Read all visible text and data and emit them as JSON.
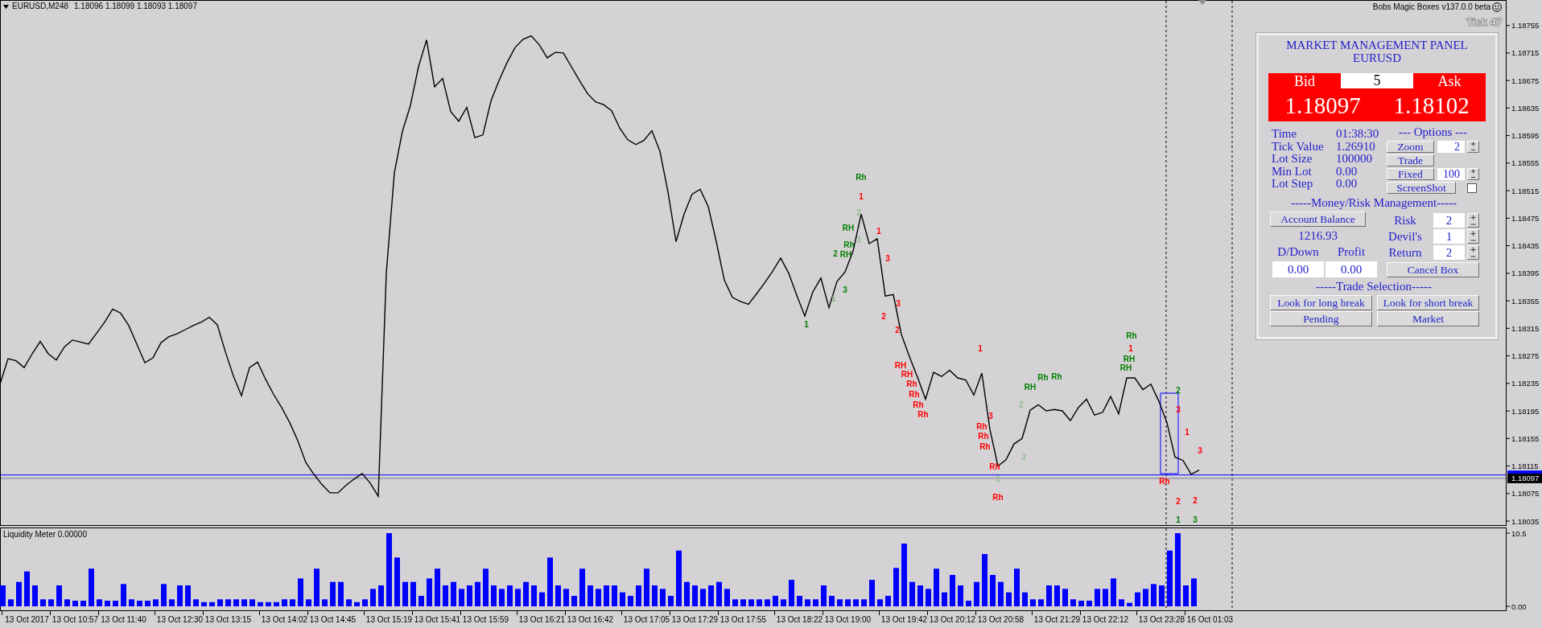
{
  "chart": {
    "header": {
      "symbol": "EURUSD,M248",
      "ohlc": "1.18096 1.18099 1.18093 1.18097"
    },
    "indicator_name": "Bobs Magic Boxes v137.0.0 beta",
    "tick_counter": "Tick 47",
    "chart_data": {
      "type": "line",
      "categories": [
        null,
        null,
        null,
        null,
        null,
        null,
        null,
        null,
        null,
        null,
        null,
        null,
        null,
        null,
        null,
        null,
        null,
        null,
        null,
        null,
        null,
        null,
        null,
        null,
        null,
        null,
        null,
        null,
        null,
        null,
        null,
        null,
        null,
        null,
        null,
        null,
        null,
        null,
        null,
        null,
        null,
        null,
        null,
        null,
        null,
        null,
        null,
        null,
        null,
        null,
        null,
        null,
        null,
        null,
        null,
        null,
        null,
        null,
        null,
        null,
        null,
        null,
        null,
        null,
        null,
        null,
        null,
        null,
        null,
        null,
        null,
        null,
        null,
        null,
        null,
        null,
        null,
        null,
        null,
        null,
        null,
        null,
        null,
        null,
        null,
        null,
        null,
        null,
        null,
        null,
        null,
        null,
        null,
        null,
        null,
        null,
        null,
        null,
        null,
        null,
        null,
        null,
        null,
        null,
        null,
        null,
        null,
        null,
        null,
        null,
        null,
        null,
        null,
        null,
        null,
        null,
        null,
        null,
        null,
        null,
        null,
        null,
        null,
        null,
        null,
        null,
        null,
        null,
        null,
        null,
        null,
        null,
        null,
        null,
        null,
        null,
        null,
        null,
        null,
        null,
        null,
        null,
        null,
        null,
        null,
        null,
        null,
        null,
        null,
        null
      ],
      "ylim": [
        1.18028,
        1.18792
      ],
      "yticks": [
        1.18755,
        1.18715,
        1.18675,
        1.18635,
        1.18595,
        1.18555,
        1.18515,
        1.18475,
        1.18435,
        1.18395,
        1.18355,
        1.18315,
        1.18275,
        1.18235,
        1.18195,
        1.18155,
        1.18115,
        1.18075,
        1.18035
      ],
      "series": [
        {
          "color": "#000000",
          "values": [
            1.18234,
            1.18271,
            1.18268,
            1.18258,
            1.18278,
            1.18296,
            1.18278,
            1.18269,
            1.18288,
            1.18298,
            1.18295,
            1.18292,
            1.18308,
            1.18324,
            1.18343,
            1.18337,
            1.18319,
            1.18292,
            1.18265,
            1.18272,
            1.18294,
            1.18303,
            1.18307,
            1.18313,
            1.18319,
            1.18324,
            1.18331,
            1.1832,
            1.18281,
            1.18246,
            1.18217,
            1.18258,
            1.18266,
            1.18241,
            1.18219,
            1.182,
            1.18178,
            1.18152,
            1.1812,
            1.18103,
            1.18088,
            1.18076,
            1.18076,
            1.18087,
            1.18096,
            1.18104,
            1.1809,
            1.18071,
            1.18395,
            1.18541,
            1.18601,
            1.18639,
            1.18695,
            1.18734,
            1.18666,
            1.18678,
            1.1863,
            1.18616,
            1.18636,
            1.18592,
            1.18596,
            1.18645,
            1.18675,
            1.18701,
            1.18723,
            1.18735,
            1.1874,
            1.18727,
            1.18708,
            1.18716,
            1.18715,
            1.18695,
            1.18675,
            1.18656,
            1.18644,
            1.1864,
            1.18631,
            1.18606,
            1.18589,
            1.18582,
            1.18588,
            1.18602,
            1.18572,
            1.18513,
            1.18441,
            1.18481,
            1.1851,
            1.18517,
            1.18492,
            1.18441,
            1.18385,
            1.1836,
            1.18354,
            1.1835,
            1.18365,
            1.18381,
            1.18398,
            1.18417,
            1.18395,
            1.18363,
            1.18333,
            1.18368,
            1.18388,
            1.18345,
            1.18383,
            1.18397,
            1.18427,
            1.18481,
            1.18438,
            1.18445,
            1.18362,
            1.18364,
            1.18306,
            1.18274,
            1.18244,
            1.18212,
            1.18251,
            1.18245,
            1.18254,
            1.18243,
            1.1824,
            1.18218,
            1.1825,
            1.18168,
            1.18115,
            1.18124,
            1.18147,
            1.18155,
            1.18196,
            1.18204,
            1.18195,
            1.18197,
            1.18195,
            1.18181,
            1.182,
            1.18212,
            1.18189,
            1.18193,
            1.18216,
            1.18191,
            1.18243,
            1.18243,
            1.18226,
            1.18234,
            1.18209,
            1.18178,
            1.18128,
            1.18123,
            1.18103,
            1.18109
          ]
        }
      ],
      "ref_lines": [
        {
          "axis": "y",
          "value": 1.18102,
          "color": "#0000ff"
        },
        {
          "axis": "y",
          "value": 1.18097,
          "color": "#7a7a9a",
          "label": "1.18097"
        }
      ]
    },
    "signal_labels": [
      {
        "text": "Rh",
        "color": "#008000"
      },
      {
        "text": "1",
        "color": "#ff0000"
      },
      {
        "text": "2",
        "color": "#8fbc8f"
      },
      {
        "text": "RH",
        "color": "#008000"
      },
      {
        "text": "1",
        "color": "#ff0000"
      },
      {
        "text": "3",
        "color": "#8fbc8f"
      },
      {
        "text": "Rh",
        "color": "#008000"
      },
      {
        "text": "2",
        "color": "#008000"
      },
      {
        "text": "RH",
        "color": "#008000"
      },
      {
        "text": "3",
        "color": "#ff0000"
      },
      {
        "text": "3",
        "color": "#008000"
      },
      {
        "text": "1",
        "color": "#8fbc8f"
      },
      {
        "text": "3",
        "color": "#ff0000"
      },
      {
        "text": "2",
        "color": "#ff0000"
      },
      {
        "text": "1",
        "color": "#008000"
      },
      {
        "text": "2",
        "color": "#ff0000"
      },
      {
        "text": "RH",
        "color": "#ff0000"
      },
      {
        "text": "RH",
        "color": "#ff0000"
      },
      {
        "text": "Rh",
        "color": "#ff0000"
      },
      {
        "text": "Rh",
        "color": "#ff0000"
      },
      {
        "text": "Rh",
        "color": "#ff0000"
      },
      {
        "text": "Rh",
        "color": "#ff0000"
      },
      {
        "text": "1",
        "color": "#ff0000"
      },
      {
        "text": "3",
        "color": "#ff0000"
      },
      {
        "text": "Rh",
        "color": "#ff0000"
      },
      {
        "text": "Rh",
        "color": "#ff0000"
      },
      {
        "text": "Rh",
        "color": "#ff0000"
      },
      {
        "text": "Rh",
        "color": "#ff0000"
      },
      {
        "text": "1",
        "color": "#8fbc8f"
      },
      {
        "text": "Rh",
        "color": "#ff0000"
      },
      {
        "text": "2",
        "color": "#8fbc8f"
      },
      {
        "text": "3",
        "color": "#8fbc8f"
      },
      {
        "text": "RH",
        "color": "#008000"
      },
      {
        "text": "Rh",
        "color": "#008000"
      },
      {
        "text": "Rh",
        "color": "#008000"
      },
      {
        "text": "Rh",
        "color": "#008000"
      },
      {
        "text": "1",
        "color": "#ff0000"
      },
      {
        "text": "RH",
        "color": "#008000"
      },
      {
        "text": "RH",
        "color": "#008000"
      },
      {
        "text": "2",
        "color": "#008000"
      },
      {
        "text": "3",
        "color": "#ff0000"
      },
      {
        "text": "1",
        "color": "#ff0000"
      },
      {
        "text": "3",
        "color": "#ff0000"
      },
      {
        "text": "Rh",
        "color": "#ff0000"
      },
      {
        "text": "2",
        "color": "#ff0000"
      },
      {
        "text": "2",
        "color": "#ff0000"
      },
      {
        "text": "1",
        "color": "#008000"
      },
      {
        "text": "3",
        "color": "#008000"
      }
    ]
  },
  "panel": {
    "title": "MARKET MANAGEMENT PANEL",
    "symbol": "EURUSD",
    "quote": {
      "bid_label": "Bid",
      "spread": "5",
      "ask_label": "Ask",
      "bid": "1.18097",
      "ask": "1.18102"
    },
    "info": [
      {
        "label": "Time",
        "value": "01:38:30"
      },
      {
        "label": "Tick Value",
        "value": "1.26910"
      },
      {
        "label": "Lot Size",
        "value": "100000"
      },
      {
        "label": "Min Lot",
        "value": "0.00"
      },
      {
        "label": "Lot Step",
        "value": "0.00"
      }
    ],
    "options": {
      "heading": "--- Options ---",
      "rows": [
        {
          "kind": "stepper",
          "label": "Zoom",
          "value": "2"
        },
        {
          "kind": "button",
          "label": "Trade"
        },
        {
          "kind": "stepper",
          "label": "Fixed",
          "value": "100"
        },
        {
          "kind": "checkbox",
          "label": "ScreenShot",
          "checked": false
        }
      ]
    },
    "money_heading": "-----Money/Risk Management-----",
    "account_button": "Account Balance",
    "balance": "1216.93",
    "totals": [
      {
        "label": "D/Down",
        "value": "0.00"
      },
      {
        "label": "Profit",
        "value": "0.00"
      }
    ],
    "risk_fields": [
      {
        "label": "Risk",
        "value": "2"
      },
      {
        "label": "Devil's",
        "value": "1"
      },
      {
        "label": "Return",
        "value": "2"
      }
    ],
    "cancel_button": "Cancel Box",
    "trade_heading": "-----Trade Selection-----",
    "trade_buttons": [
      "Look for long break",
      "Look for short break",
      "Pending",
      "Market"
    ]
  },
  "liquidity_meter": {
    "chart_data": {
      "type": "bar",
      "title": "Liquidity Meter 0.00000",
      "categories": [
        null,
        null,
        null,
        "13 Oct 2017",
        null,
        null,
        null,
        null,
        null,
        "13 Oct 10:57",
        null,
        null,
        null,
        null,
        null,
        "13 Oct 11:40",
        null,
        null,
        null,
        null,
        null,
        null,
        "13 Oct 12:30",
        null,
        null,
        null,
        null,
        null,
        "13 Oct 13:15",
        null,
        null,
        null,
        null,
        null,
        null,
        "13 Oct 14:02",
        null,
        null,
        null,
        null,
        null,
        "13 Oct 14:45",
        null,
        null,
        null,
        null,
        null,
        null,
        "13 Oct 15:19",
        null,
        null,
        null,
        null,
        null,
        "13 Oct 15:41",
        null,
        null,
        null,
        null,
        null,
        "13 Oct 15:59",
        null,
        null,
        null,
        null,
        null,
        null,
        "13 Oct 16:21",
        null,
        null,
        null,
        null,
        null,
        "13 Oct 16:42",
        null,
        null,
        null,
        null,
        null,
        null,
        "13 Oct 17:05",
        null,
        null,
        null,
        null,
        null,
        "13 Oct 17:29",
        null,
        null,
        null,
        null,
        null,
        "13 Oct 17:55",
        null,
        null,
        null,
        null,
        null,
        null,
        "13 Oct 18:22",
        null,
        null,
        null,
        null,
        null,
        "13 Oct 19:00",
        null,
        null,
        null,
        null,
        null,
        null,
        "13 Oct 19:42",
        null,
        null,
        null,
        null,
        null,
        "13 Oct 20:12",
        null,
        null,
        null,
        null,
        null,
        "13 Oct 20:58",
        null,
        null,
        null,
        null,
        null,
        null,
        "13 Oct 21:29",
        null,
        null,
        null,
        null,
        null,
        "13 Oct 22:12",
        null,
        null,
        null,
        null,
        null,
        null,
        "13 Oct 23:28",
        null,
        null,
        null,
        null,
        null,
        "16 Oct 01:03",
        null,
        null,
        null,
        null,
        null,
        null,
        null,
        null,
        null,
        null,
        null,
        null,
        null,
        null,
        null,
        null,
        null,
        null,
        null,
        null,
        null,
        null,
        null,
        null,
        null,
        null,
        null,
        null,
        null,
        null,
        null,
        null,
        null,
        null,
        null,
        null
      ],
      "ylim": [
        -0.69,
        11.31
      ],
      "yticks": [
        {
          "value": 10.5,
          "label": "10.5"
        },
        {
          "value": 0,
          "label": "0.00"
        }
      ],
      "series": [
        {
          "color": "#0000ff",
          "values": [
            3.0,
            1.0,
            3.5,
            5.0,
            3.0,
            1.0,
            1.0,
            3.0,
            1.0,
            0.8,
            0.8,
            5.4,
            1.0,
            0.8,
            0.8,
            3.2,
            1.0,
            0.8,
            0.8,
            1.0,
            3.2,
            1.0,
            3.0,
            3.0,
            1.0,
            0.6,
            0.6,
            1.0,
            1.0,
            1.0,
            1.0,
            1.0,
            0.6,
            0.6,
            0.6,
            1.0,
            1.0,
            4.0,
            1.0,
            5.4,
            1.0,
            3.5,
            3.5,
            1.0,
            0.6,
            1.0,
            2.5,
            3.0,
            10.5,
            7.0,
            3.5,
            3.5,
            1.5,
            4.0,
            5.4,
            3.0,
            3.5,
            2.5,
            3.0,
            3.5,
            5.4,
            3.0,
            2.5,
            3.0,
            2.5,
            3.5,
            3.0,
            2.0,
            7.0,
            3.0,
            2.5,
            1.5,
            5.4,
            3.0,
            2.5,
            3.0,
            3.0,
            2.0,
            1.5,
            3.0,
            5.4,
            3.0,
            2.5,
            1.5,
            8.0,
            3.5,
            3.0,
            2.5,
            3.0,
            3.5,
            2.5,
            1.0,
            1.0,
            1.0,
            1.0,
            1.0,
            1.5,
            1.0,
            3.8,
            1.5,
            1.0,
            1.0,
            3.0,
            1.5,
            1.0,
            1.0,
            1.0,
            1.0,
            3.8,
            1.0,
            1.5,
            5.5,
            9.0,
            3.5,
            3.0,
            2.5,
            5.4,
            2.0,
            4.5,
            3.0,
            0.8,
            3.5,
            7.5,
            4.5,
            3.5,
            2.0,
            5.4,
            2.0,
            1.0,
            1.0,
            3.0,
            3.0,
            2.5,
            1.0,
            0.8,
            0.8,
            2.5,
            2.5,
            4.0,
            1.0,
            0.5,
            2.0,
            2.5,
            3.2,
            3.0,
            8.0,
            10.5,
            3.0,
            4.0,
            null,
            null,
            null,
            null,
            null,
            null,
            null,
            null,
            null,
            null,
            null,
            null,
            null,
            null,
            null,
            null,
            null,
            null,
            null,
            null,
            null,
            null,
            null,
            null,
            null,
            null,
            null,
            null,
            null,
            null,
            null,
            null,
            null,
            null,
            null,
            null,
            null,
            null
          ]
        }
      ]
    }
  }
}
